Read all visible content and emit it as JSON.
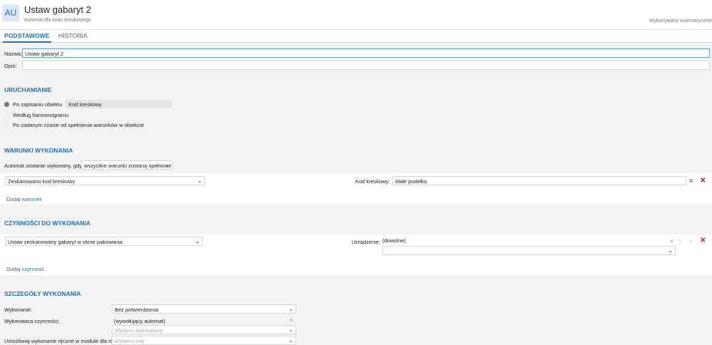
{
  "header": {
    "avatar": "AU",
    "title": "Ustaw gabaryt 2",
    "subtitle": "Automat dla kodu kreskowego",
    "status": "Wykonywany automatycznie"
  },
  "tabs": [
    {
      "label": "PODSTAWOWE",
      "active": true
    },
    {
      "label": "HISTORIA",
      "active": false
    }
  ],
  "basic": {
    "name_label": "Nazwa:",
    "name_value": "Ustaw gabaryt 2",
    "desc_label": "Opis:",
    "desc_value": ""
  },
  "trigger": {
    "title": "URUCHAMIANIE",
    "options": [
      {
        "label": "Po zapisaniu obiektu",
        "checked": true,
        "chip": "Kod kreskowy"
      },
      {
        "label": "Według harmonogramu",
        "checked": false
      },
      {
        "label": "Po zadanym czasie od spełnienia warunków w obiekcie",
        "checked": false
      }
    ]
  },
  "conditions": {
    "title": "WARUNKI WYKONANIA",
    "intro_label": "Automat zostanie wykonany, gdy",
    "intro_select": "wszystkie warunki zostaną spełnione",
    "row": {
      "condition": "Zeskanowano kod kreskowy",
      "field_label": "Kod kreskowy:",
      "field_value": "Małe pudełko"
    },
    "add_link": "Dodaj warunek"
  },
  "actions": {
    "title": "CZYNNOŚCI DO WYKONANIA",
    "row": {
      "action": "Ustaw zeskanowany gabaryt w oknie pakowania",
      "device_label": "Urządzenie:",
      "device_value": "(dowolne)"
    },
    "add_link": "Dodaj czynność"
  },
  "details": {
    "title": "SZCZEGÓŁY WYKONANIA",
    "execution_label": "Wykonanie:",
    "execution_value": "Bez potwierdzenia",
    "executor_label": "Wykonawca czynności:",
    "executor_value": "(wywołujący automat)",
    "executor_placeholder": "Wybierz wykonawcę",
    "manual_label": "Umożliwiaj wykonanie ręczne w module dla ról:",
    "manual_placeholder": "Wybierz rolę"
  },
  "colors": {
    "accent": "#1d6fb8",
    "delete": "#dd1111"
  }
}
